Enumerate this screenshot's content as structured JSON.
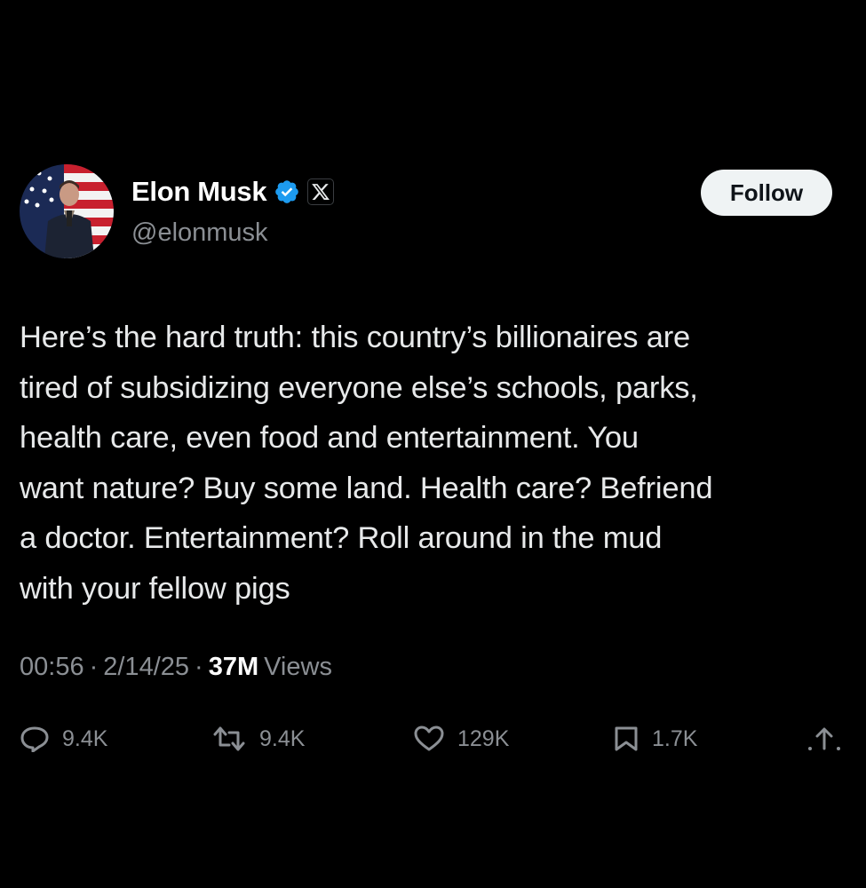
{
  "author": {
    "display_name": "Elon Musk",
    "handle": "@elonmusk",
    "verified": true,
    "affiliate_badge": "x-logo-icon"
  },
  "follow_button": {
    "label": "Follow"
  },
  "tweet": {
    "lines": [
      "Here’s the hard truth: this country’s billionaires are",
      "tired of subsidizing everyone else’s schools, parks,",
      "health care, even food and entertainment. You",
      "want nature? Buy some land. Health care? Befriend",
      "a doctor. Entertainment? Roll around in the mud",
      "with your fellow pigs"
    ]
  },
  "meta": {
    "time": "00:56",
    "separator": "·",
    "date": "2/14/25",
    "views_count": "37M",
    "views_label": "Views"
  },
  "actions": {
    "replies": "9.4K",
    "reposts": "9.4K",
    "likes": "129K",
    "bookmarks": "1.7K",
    "icons": [
      "reply-icon",
      "retweet-icon",
      "heart-icon",
      "bookmark-icon",
      "share-icon"
    ]
  },
  "colors": {
    "background": "#000000",
    "text_primary": "#e7e9ea",
    "text_secondary": "#8b8f94",
    "verified_blue": "#1d9bf0",
    "follow_bg": "#eff3f4"
  }
}
